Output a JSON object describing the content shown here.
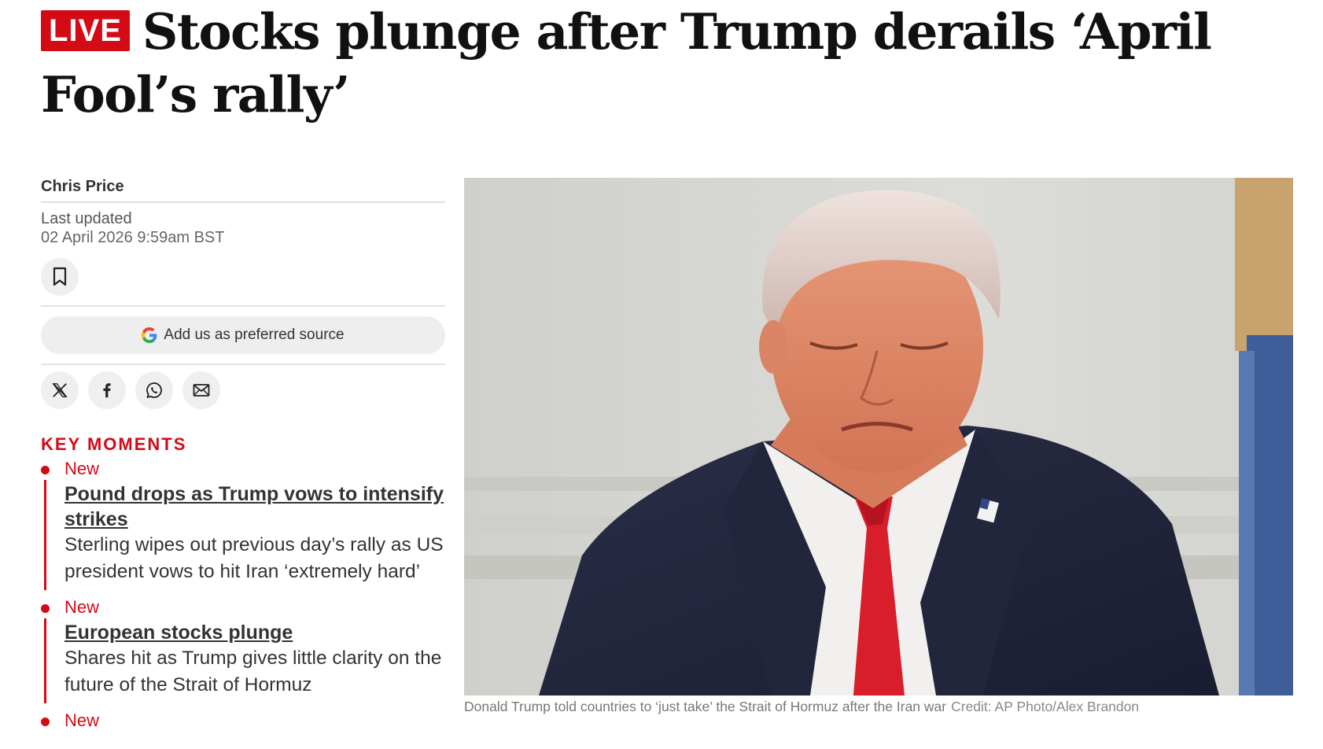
{
  "article": {
    "live_badge": "LIVE",
    "headline": "Stocks plunge after Trump derails ‘April Fool’s rally’"
  },
  "byline": {
    "author": "Chris Price",
    "updated_label": "Last updated",
    "updated_date": "02 April 2026 9:59am BST"
  },
  "actions": {
    "preferred_source_label": "Add us as preferred source",
    "share_icons": [
      "x-icon",
      "facebook-icon",
      "whatsapp-icon",
      "email-icon"
    ],
    "bookmark_icon": "bookmark-icon"
  },
  "key_moments": {
    "title": "KEY MOMENTS",
    "items": [
      {
        "tag": "New",
        "title": "Pound drops as Trump vows to intensify strikes",
        "description": "Sterling wipes out previous day’s rally as US president vows to hit Iran ‘extremely hard’"
      },
      {
        "tag": "New",
        "title": "European stocks plunge",
        "description": "Shares hit as Trump gives little clarity on the future of the Strait of Hormuz"
      },
      {
        "tag": "New"
      }
    ]
  },
  "hero_image": {
    "caption": "Donald Trump told countries to ‘just take’ the Strait of Hormuz after the Iran war",
    "credit": "Credit: AP Photo/Alex Brandon"
  },
  "colors": {
    "accent_red": "#d40a15",
    "text_dark": "#111111",
    "muted_gray": "#666666"
  }
}
